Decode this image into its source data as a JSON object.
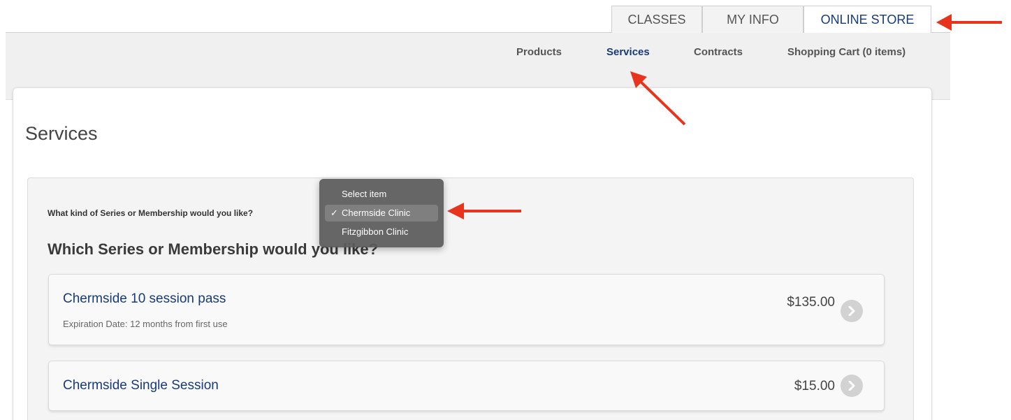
{
  "tabs": [
    {
      "label": "CLASSES"
    },
    {
      "label": "MY INFO"
    },
    {
      "label": "ONLINE STORE",
      "active": true
    }
  ],
  "subnav": {
    "products": "Products",
    "services": "Services",
    "contracts": "Contracts",
    "cart": "Shopping Cart (0 items)"
  },
  "page": {
    "title": "Services",
    "question": "What kind of Series or Membership would you like?",
    "which": "Which Series or Membership would you like?"
  },
  "dropdown": {
    "options": [
      {
        "label": "Select item"
      },
      {
        "label": "Chermside Clinic",
        "selected": true
      },
      {
        "label": "Fitzgibbon Clinic"
      }
    ],
    "checkmark": "✓"
  },
  "items": [
    {
      "name": "Chermside 10 session pass",
      "expiration": "Expiration Date: 12 months from first use",
      "price": "$135.00"
    },
    {
      "name": "Chermside Single Session",
      "price": "$15.00"
    }
  ],
  "colors": {
    "brand": "#173a7a",
    "annotation_arrow": "#e8341c"
  }
}
